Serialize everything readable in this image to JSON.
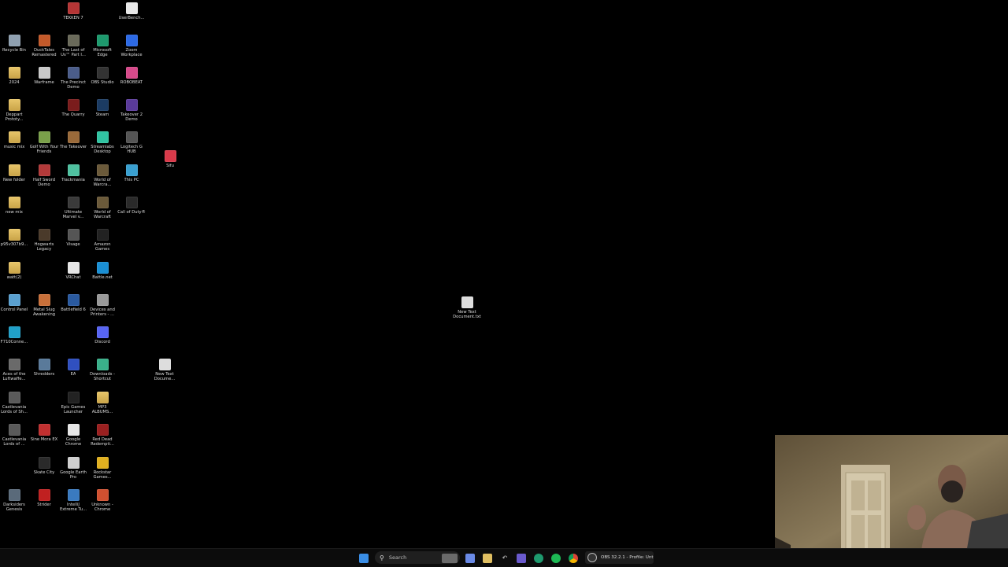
{
  "desktop": {
    "icons": [
      {
        "label": "TEKKEN 7",
        "icon": "tekken-icon",
        "color": "#b53535"
      },
      {
        "label": "UserBench...",
        "icon": "userbenchmark-icon",
        "color": "#e8e8e8"
      },
      {
        "label": "Recycle Bin",
        "icon": "recycle-bin-icon",
        "color": "#8fa0b0"
      },
      {
        "label": "DuckTales Remastered",
        "icon": "ducktales-icon",
        "color": "#c45a2a"
      },
      {
        "label": "The Last of Us™ Part I...",
        "icon": "tlou-icon",
        "color": "#6a6a5a"
      },
      {
        "label": "Microsoft Edge",
        "icon": "edge-icon",
        "color": "#1e9a6e"
      },
      {
        "label": "Zoom Workplace",
        "icon": "zoom-icon",
        "color": "#2d6ae5"
      },
      {
        "label": "2024",
        "icon": "folder-icon",
        "color": "#e0bf62"
      },
      {
        "label": "Warframe",
        "icon": "warframe-icon",
        "color": "#c9c9c9"
      },
      {
        "label": "The Precinct Demo",
        "icon": "precinct-icon",
        "color": "#4b5d8a"
      },
      {
        "label": "OBS Studio",
        "icon": "obs-icon",
        "color": "#333333"
      },
      {
        "label": "ROBOBEAT",
        "icon": "robobeat-icon",
        "color": "#d64a8a"
      },
      {
        "label": "Deppart Prototy...",
        "icon": "folder-icon",
        "color": "#e0bf62"
      },
      {
        "label": "The Quarry",
        "icon": "quarry-icon",
        "color": "#7a1c1c"
      },
      {
        "label": "Steam",
        "icon": "steam-icon",
        "color": "#1b3b63"
      },
      {
        "label": "Takeover 2 Demo",
        "icon": "takeover2-icon",
        "color": "#5a3a9a"
      },
      {
        "label": "music mix",
        "icon": "folder-icon",
        "color": "#e0bf62"
      },
      {
        "label": "Golf With Your Friends",
        "icon": "golf-icon",
        "color": "#7aa04a"
      },
      {
        "label": "The Takeover",
        "icon": "takeover-icon",
        "color": "#9a6a3a"
      },
      {
        "label": "Streamlabs Desktop",
        "icon": "streamlabs-icon",
        "color": "#31c3a2"
      },
      {
        "label": "Logitech G HUB",
        "icon": "ghub-icon",
        "color": "#555555"
      },
      {
        "label": "Sifu",
        "icon": "sifu-icon",
        "color": "#d93a4a"
      },
      {
        "label": "New folder",
        "icon": "folder-icon",
        "color": "#e0bf62"
      },
      {
        "label": "Half Sword Demo",
        "icon": "half-sword-icon",
        "color": "#b33a3a"
      },
      {
        "label": "Trackmania",
        "icon": "trackmania-icon",
        "color": "#4fc1a0"
      },
      {
        "label": "World of Warcra...",
        "icon": "wow-icon",
        "color": "#6b5a3a"
      },
      {
        "label": "This PC",
        "icon": "this-pc-icon",
        "color": "#3aa0d0"
      },
      {
        "label": "new mix",
        "icon": "folder-icon",
        "color": "#e0bf62"
      },
      {
        "label": "Ultimate Marvel v...",
        "icon": "marvel-icon",
        "color": "#3a3a3a"
      },
      {
        "label": "World of Warcraft",
        "icon": "wow-classic-icon",
        "color": "#6b5a3a"
      },
      {
        "label": "Call of Duty®",
        "icon": "cod-icon",
        "color": "#2a2a2a"
      },
      {
        "label": "p95v307b9...",
        "icon": "folder-icon",
        "color": "#e0bf62"
      },
      {
        "label": "Hogwarts Legacy",
        "icon": "hogwarts-icon",
        "color": "#4a3a2a"
      },
      {
        "label": "Visage",
        "icon": "visage-icon",
        "color": "#555555"
      },
      {
        "label": "Amazon Games",
        "icon": "amazon-games-icon",
        "color": "#222222"
      },
      {
        "label": "watt(2)",
        "icon": "folder-icon",
        "color": "#e0bf62"
      },
      {
        "label": "VRChat",
        "icon": "vrchat-icon",
        "color": "#e6e6e6"
      },
      {
        "label": "Battle.net",
        "icon": "battlenet-icon",
        "color": "#1a8fd4"
      },
      {
        "label": "Control Panel",
        "icon": "control-panel-icon",
        "color": "#5aa0d0"
      },
      {
        "label": "Metal Slug Awakening",
        "icon": "metal-slug-icon",
        "color": "#c8703a"
      },
      {
        "label": "Battlefield 6",
        "icon": "battlefield-icon",
        "color": "#2a5aa0"
      },
      {
        "label": "Devices and Printers - ...",
        "icon": "printer-icon",
        "color": "#999999"
      },
      {
        "label": "F710Conne...",
        "icon": "logitech-icon",
        "color": "#20a0c8"
      },
      {
        "label": "Discord",
        "icon": "discord-icon",
        "color": "#5865f2"
      },
      {
        "label": "Aces of the Luftwaffe...",
        "icon": "aces-icon",
        "color": "#6a6a6a"
      },
      {
        "label": "Shredders",
        "icon": "shredders-icon",
        "color": "#5a7a9a"
      },
      {
        "label": "EA",
        "icon": "ea-icon",
        "color": "#3050c0"
      },
      {
        "label": "Downloads - Shortcut",
        "icon": "downloads-folder-icon",
        "color": "#3ab08a"
      },
      {
        "label": "New Text Docume...",
        "icon": "text-file-icon",
        "color": "#dddddd"
      },
      {
        "label": "Castlevania Lords of Sh...",
        "icon": "castlevania-icon",
        "color": "#5a5a5a"
      },
      {
        "label": "Epic Games Launcher",
        "icon": "epic-icon",
        "color": "#222222"
      },
      {
        "label": "MP3 ALBUMS...",
        "icon": "folder-icon",
        "color": "#e0bf62"
      },
      {
        "label": "Castlevania Lords of ...",
        "icon": "castlevania2-icon",
        "color": "#5a5a5a"
      },
      {
        "label": "Sine Mora EX",
        "icon": "sine-mora-icon",
        "color": "#c03030"
      },
      {
        "label": "Google Chrome",
        "icon": "chrome-icon",
        "color": "#e6e6e6"
      },
      {
        "label": "Red Dead Redempti...",
        "icon": "rdr-icon",
        "color": "#9a2020"
      },
      {
        "label": "Skate City",
        "icon": "skate-city-icon",
        "color": "#2a2a2a"
      },
      {
        "label": "Google Earth Pro",
        "icon": "google-earth-icon",
        "color": "#cfcfcf"
      },
      {
        "label": "Rockstar Games...",
        "icon": "rockstar-icon",
        "color": "#e0b020"
      },
      {
        "label": "Darksiders Genesis",
        "icon": "darksiders-icon",
        "color": "#5a6a7a"
      },
      {
        "label": "Strider",
        "icon": "strider-icon",
        "color": "#c02020"
      },
      {
        "label": "IntelliJ Extreme Tu...",
        "icon": "intel-icon",
        "color": "#3a7ac0"
      },
      {
        "label": "Unknown - Chrome",
        "icon": "chrome-profile-icon",
        "color": "#d05030"
      },
      {
        "label": "New Text Document.txt",
        "icon": "text-file-icon",
        "color": "#dddddd"
      }
    ]
  },
  "taskbar": {
    "search_label": "Search",
    "search_icon": "search-icon",
    "obs_label": "OBS 32.2.1 - Profile: Unt",
    "pinned": [
      {
        "name": "start-button",
        "icon": "windows-icon",
        "color": "#3a8ee6"
      },
      {
        "name": "widgets-button",
        "icon": "widgets-icon",
        "color": "#7a7a7a"
      },
      {
        "name": "copilot-button",
        "icon": "copilot-icon",
        "color": "#6a8ae6"
      },
      {
        "name": "file-explorer-button",
        "icon": "folder-icon",
        "color": "#e0bf62"
      },
      {
        "name": "back-arrow-button",
        "icon": "arrow-icon",
        "color": "#bbbbbb"
      },
      {
        "name": "teams-button",
        "icon": "teams-icon",
        "color": "#6a5acd"
      },
      {
        "name": "edge-button",
        "icon": "edge-icon",
        "color": "#1e9a6e"
      },
      {
        "name": "spotify-button",
        "icon": "spotify-icon",
        "color": "#1db954"
      },
      {
        "name": "chrome-button",
        "icon": "chrome-icon",
        "color": "#e0a030"
      }
    ]
  },
  "webcam": {
    "label": "webcam-overlay"
  }
}
